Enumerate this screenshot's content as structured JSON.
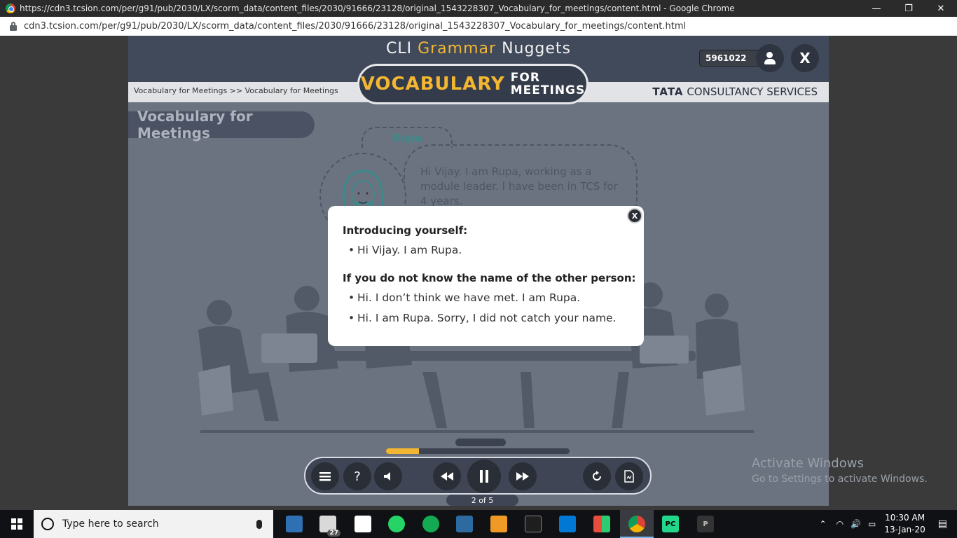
{
  "browser": {
    "window_title": "https://cdn3.tcsion.com/per/g91/pub/2030/LX/scorm_data/content_files/2030/91666/23128/original_1543228307_Vocabulary_for_meetings/content.html - Google Chrome",
    "url": "cdn3.tcsion.com/per/g91/pub/2030/LX/scorm_data/content_files/2030/91666/23128/original_1543228307_Vocabulary_for_meetings/content.html",
    "minimize": "—",
    "restore": "❐",
    "close": "✕"
  },
  "header": {
    "brand_prefix": "CLI",
    "brand_accent": "Grammar",
    "brand_suffix": "Nuggets",
    "badge_big": "VOCABULARY",
    "badge_small_1": "FOR",
    "badge_small_2": "MEETINGS",
    "breadcrumb": "Vocabulary for Meetings >> Vocabulary for Meetings",
    "tcs_tata": "TATA",
    "tcs_rest": "CONSULTANCY SERVICES",
    "user_id": "5961022",
    "close_label": "X"
  },
  "content": {
    "section_title": "Vocabulary for Meetings",
    "speaker_name": "Rupa",
    "speech": "Hi Vijay. I am Rupa, working as a module leader. I have been in TCS for 4 years."
  },
  "modal": {
    "close_label": "X",
    "heading_1": "Introducing yourself:",
    "items_1": [
      "Hi Vijay. I am Rupa."
    ],
    "heading_2": "If you do not know the name of the other person:",
    "items_2": [
      "Hi. I don’t think we have met. I am Rupa.",
      "Hi. I am Rupa. Sorry, I did not catch your name."
    ]
  },
  "player": {
    "progress": 0.18,
    "page_counter": "2 of 5",
    "menu_icon": "menu-icon",
    "help_label": "?",
    "volume_icon": "speaker-icon",
    "rewind_icon": "rewind-icon",
    "pause_icon": "pause-icon",
    "forward_icon": "fast-forward-icon",
    "replay_icon": "replay-icon",
    "transcript_icon": "document-icon"
  },
  "watermark": {
    "line1": "Activate Windows",
    "line2": "Go to Settings to activate Windows."
  },
  "taskbar": {
    "search_placeholder": "Type here to search",
    "mail_badge": "27",
    "time": "10:30 AM",
    "date": "13-Jan-20"
  },
  "colors": {
    "accent": "#f2b632",
    "course_bg": "#6c7380",
    "header_bg": "#414a5b",
    "speaker_name": "#3c8b8c"
  }
}
